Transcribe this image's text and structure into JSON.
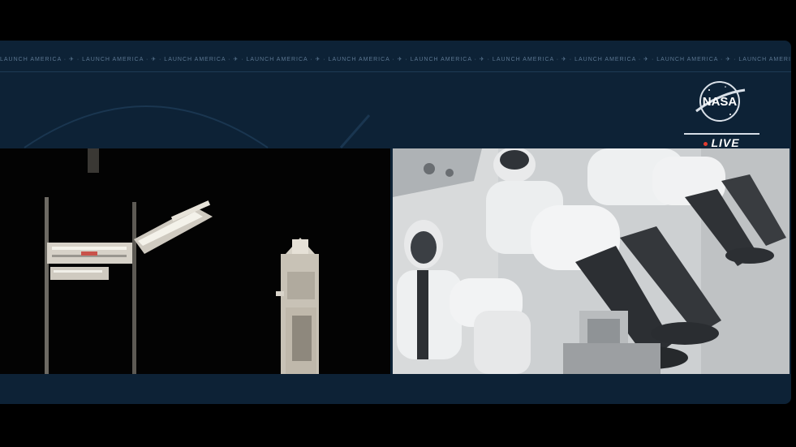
{
  "broadcast": {
    "ticker_text": "LAUNCH AMERICA  ·  ✈  ·  LAUNCH AMERICA  ·  ✈  ·  LAUNCH AMERICA  ·  ✈  ·  LAUNCH AMERICA  ·  ✈  ·  LAUNCH AMERICA  ·  ✈  ·  LAUNCH AMERICA  ·  ✈  ·  LAUNCH AMERICA  ·  ✈  ·  LAUNCH AMERICA  ·  ✈  ·  LAUNCH AMERICA  ·  ✈  ·  LAUNCH AMERICA",
    "live_label": "LIVE",
    "logo_icon": "nasa-meatball-logo",
    "colors": {
      "panel": "#0d2236",
      "accent": "#e23b2e"
    }
  },
  "feeds": {
    "left": {
      "description_icon": "launch-tower-video"
    },
    "right": {
      "description_icon": "crew-cabin-video"
    }
  }
}
